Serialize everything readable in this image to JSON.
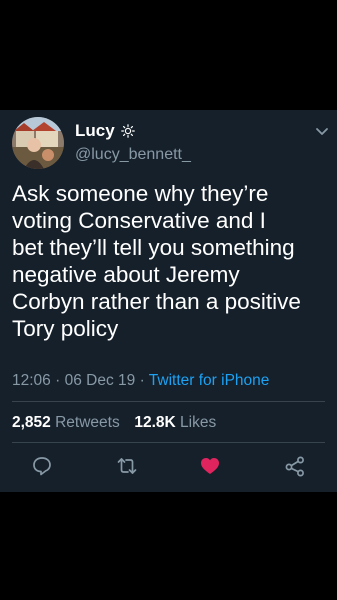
{
  "tweet": {
    "display_name": "Lucy",
    "handle": "@lucy_bennett_",
    "text": "Ask someone why they’re\nvoting Conservative and I\nbet they’ll tell you something\nnegative about Jeremy\nCorbyn rather than a positive\nTory policy",
    "time": "12:06",
    "date": "06 Dec 19",
    "source": "Twitter for iPhone",
    "separator": "·",
    "retweets_count": "2,852",
    "retweets_label": "Retweets",
    "likes_count": "12.8K",
    "likes_label": "Likes"
  },
  "icons": {
    "name_flair": "sun-icon",
    "menu": "chevron-down-icon",
    "reply": "reply-icon",
    "retweet": "retweet-icon",
    "like": "heart-icon",
    "share": "share-icon"
  },
  "colors": {
    "page_background": "#000000",
    "card_background": "#15202b",
    "primary_text": "#ffffff",
    "secondary_text": "#8899a6",
    "link": "#1da1f2",
    "like_active": "#e0245e",
    "divider": "#38444d"
  },
  "state": {
    "liked": true
  }
}
